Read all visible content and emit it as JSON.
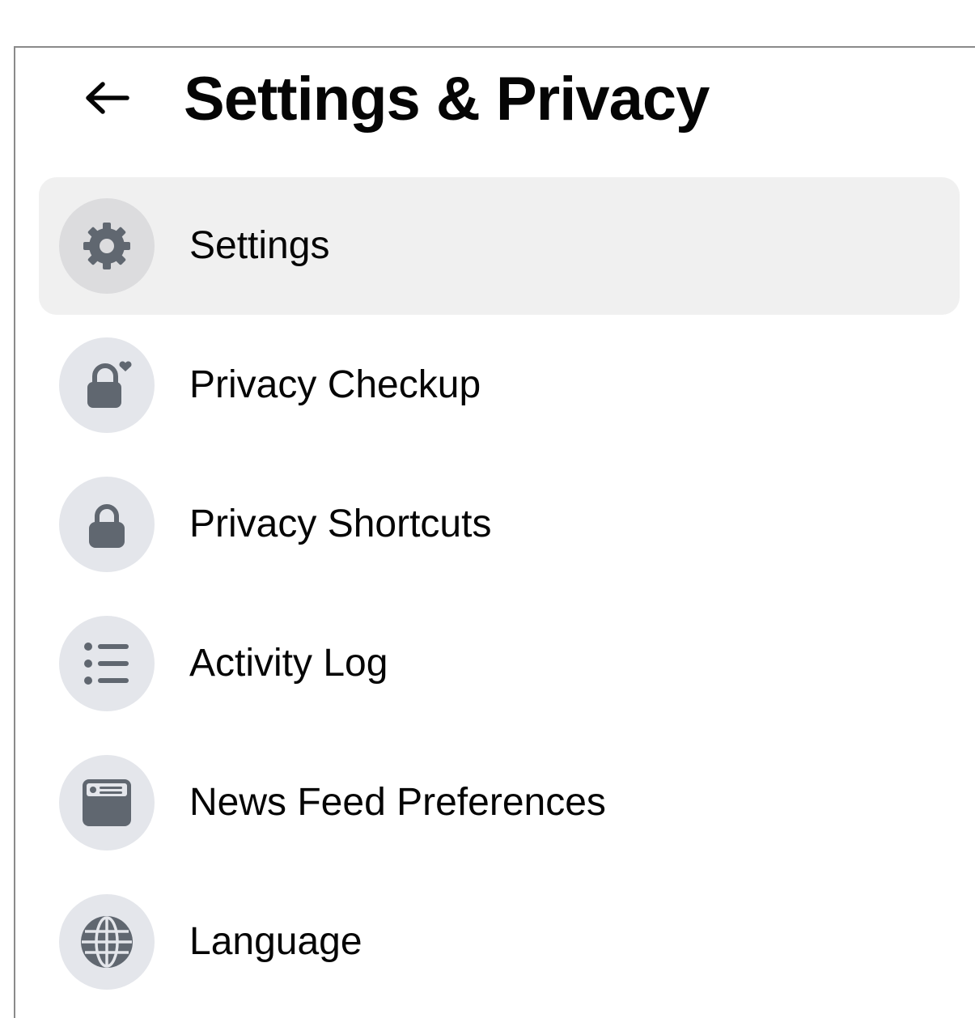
{
  "header": {
    "back_icon": "arrow-left-icon",
    "title": "Settings & Privacy"
  },
  "menu": {
    "items": [
      {
        "label": "Settings",
        "icon": "gear-icon",
        "active": true
      },
      {
        "label": "Privacy Checkup",
        "icon": "lock-heart-icon",
        "active": false
      },
      {
        "label": "Privacy Shortcuts",
        "icon": "lock-icon",
        "active": false
      },
      {
        "label": "Activity Log",
        "icon": "list-icon",
        "active": false
      },
      {
        "label": "News Feed Preferences",
        "icon": "news-feed-icon",
        "active": false
      },
      {
        "label": "Language",
        "icon": "globe-icon",
        "active": false
      }
    ]
  },
  "colors": {
    "text": "#050505",
    "icon": "#606770",
    "icon_bg": "#e4e6eb",
    "active_bg": "#f0f0f0",
    "border": "#8a8a8a"
  }
}
